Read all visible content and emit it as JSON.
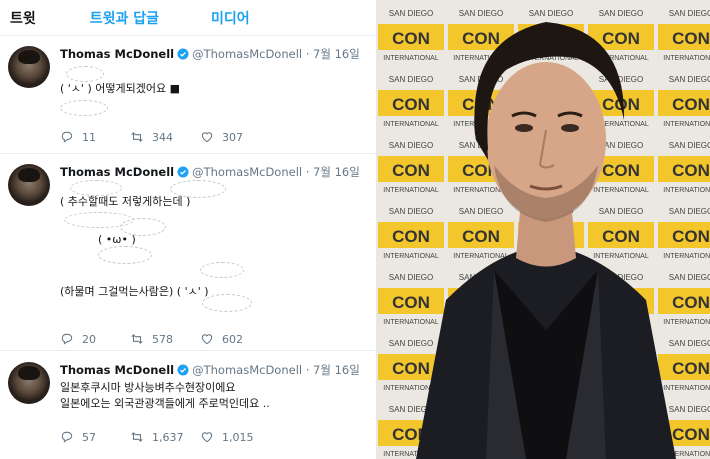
{
  "tabs": [
    "트윗",
    "트윗과 답글",
    "미디어"
  ],
  "tweets": [
    {
      "name": "Thomas McDonell",
      "handle": "@ThomasMcDonell · 7월 16일",
      "lines": [
        "( 'ㅅ'     ) 어떻게되겠어요  ■"
      ],
      "replies": "11",
      "retweets": "344",
      "likes": "307"
    },
    {
      "name": "Thomas McDonell",
      "handle": "@ThomasMcDonell · 7월 16일",
      "lines": [
        "( 추수할때도 저렇게하는데 )",
        "( •ω• )",
        "(하물며 그걸먹는사람은) ( 'ㅅ'     )"
      ],
      "replies": "20",
      "retweets": "578",
      "likes": "602"
    },
    {
      "name": "Thomas McDonell",
      "handle": "@ThomasMcDonell · 7월 16일",
      "lines": [
        "일본후쿠시마 방사능벼추수현장이에요",
        "일본에오는 외국관광객들에게 주로먹인데요 .."
      ],
      "replies": "57",
      "retweets": "1,637",
      "likes": "1,015"
    }
  ],
  "photo": {
    "backdrop_text": "COMIC CON",
    "backdrop_sub": "INTERNATIONAL",
    "backdrop_city": "SAN DIEGO"
  },
  "colors": {
    "accent": "#1da1f2",
    "muted": "#657786",
    "backdrop_yellow": "#f2c21a"
  }
}
